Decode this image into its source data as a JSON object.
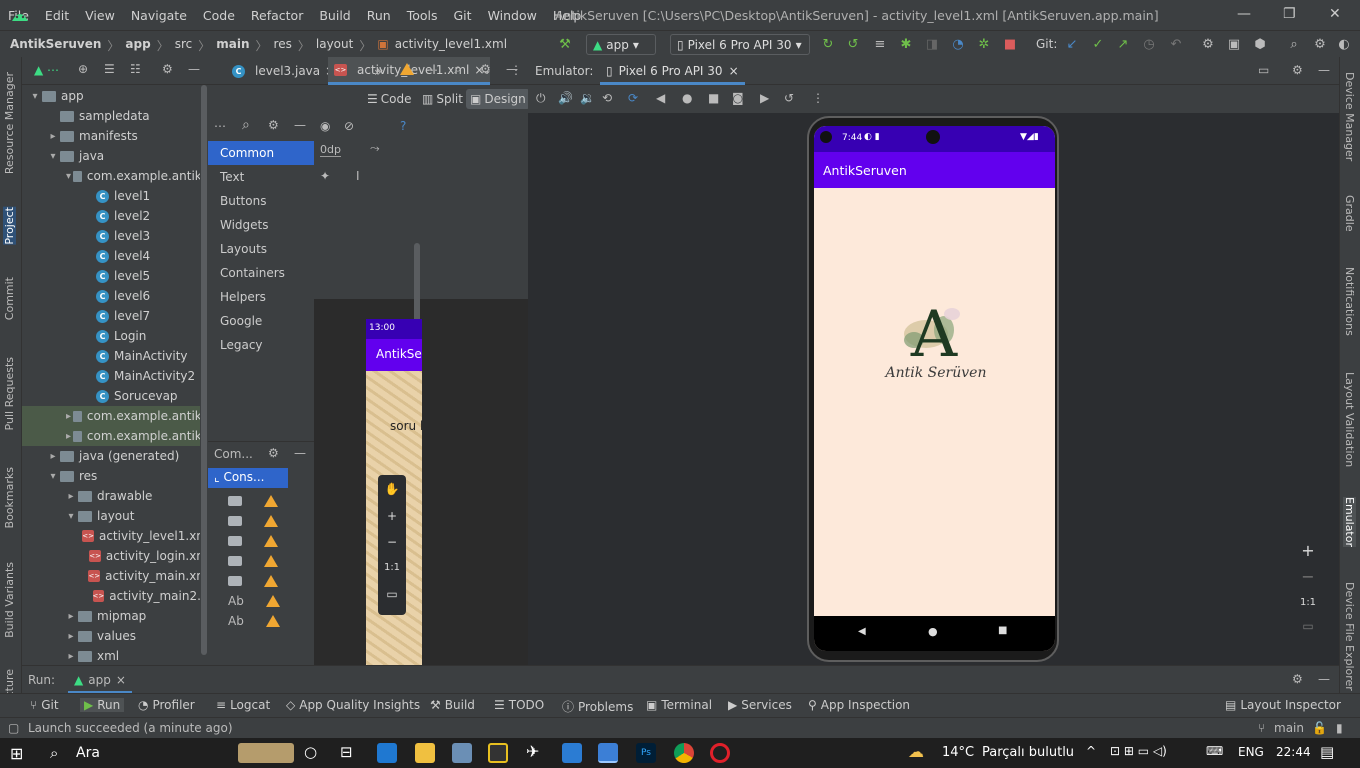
{
  "titlebar": {
    "menu": [
      "File",
      "Edit",
      "View",
      "Navigate",
      "Code",
      "Refactor",
      "Build",
      "Run",
      "Tools",
      "Git",
      "Window",
      "Help"
    ],
    "title": "AntikSeruven [C:\\Users\\PC\\Desktop\\AntikSeruven] - activity_level1.xml [AntikSeruven.app.main]"
  },
  "navbar": {
    "crumbs": [
      "AntikSeruven",
      "app",
      "src",
      "main",
      "res",
      "layout",
      "activity_level1.xml"
    ],
    "run_config": "app",
    "device": "Pixel 6 Pro API 30",
    "git_label": "Git:"
  },
  "left_strip": [
    "Resource Manager",
    "Project",
    "Commit",
    "Pull Requests",
    "Bookmarks",
    "Build Variants",
    "Structure"
  ],
  "right_strip": [
    "Device Manager",
    "Gradle",
    "Notifications",
    "Layout Validation",
    "Emulator",
    "Device File Explorer"
  ],
  "project_tree": [
    {
      "label": "app",
      "arrow": "▼",
      "icon": "folder"
    },
    {
      "label": "sampledata",
      "arrow": "",
      "icon": "folder"
    },
    {
      "label": "manifests",
      "arrow": "▶",
      "icon": "folder"
    },
    {
      "label": "java",
      "arrow": "▼",
      "icon": "folder"
    },
    {
      "label": "com.example.antiks",
      "arrow": "▼",
      "icon": "folder"
    },
    {
      "label": "level1",
      "arrow": "",
      "icon": "class"
    },
    {
      "label": "level2",
      "arrow": "",
      "icon": "class"
    },
    {
      "label": "level3",
      "arrow": "",
      "icon": "class"
    },
    {
      "label": "level4",
      "arrow": "",
      "icon": "class"
    },
    {
      "label": "level5",
      "arrow": "",
      "icon": "class"
    },
    {
      "label": "level6",
      "arrow": "",
      "icon": "class"
    },
    {
      "label": "level7",
      "arrow": "",
      "icon": "class"
    },
    {
      "label": "Login",
      "arrow": "",
      "icon": "class"
    },
    {
      "label": "MainActivity",
      "arrow": "",
      "icon": "class"
    },
    {
      "label": "MainActivity2",
      "arrow": "",
      "icon": "class"
    },
    {
      "label": "Sorucevap",
      "arrow": "",
      "icon": "class"
    },
    {
      "label": "com.example.antiks",
      "arrow": "▶",
      "icon": "folder",
      "selected": true
    },
    {
      "label": "com.example.antiks",
      "arrow": "▶",
      "icon": "folder",
      "selected": true
    },
    {
      "label": "java (generated)",
      "arrow": "▶",
      "icon": "folder"
    },
    {
      "label": "res",
      "arrow": "▼",
      "icon": "folder"
    },
    {
      "label": "drawable",
      "arrow": "▶",
      "icon": "folder"
    },
    {
      "label": "layout",
      "arrow": "▼",
      "icon": "folder"
    },
    {
      "label": "activity_level1.xm",
      "arrow": "",
      "icon": "xml"
    },
    {
      "label": "activity_login.xm",
      "arrow": "",
      "icon": "xml"
    },
    {
      "label": "activity_main.xm",
      "arrow": "",
      "icon": "xml"
    },
    {
      "label": "activity_main2.x",
      "arrow": "",
      "icon": "xml"
    },
    {
      "label": "mipmap",
      "arrow": "▶",
      "icon": "folder"
    },
    {
      "label": "values",
      "arrow": "▶",
      "icon": "folder"
    },
    {
      "label": "xml",
      "arrow": "▶",
      "icon": "folder"
    }
  ],
  "editor": {
    "tabs": [
      "level3.java",
      "activity_level1.xml"
    ],
    "modes": [
      "Code",
      "Split",
      "Design"
    ],
    "zero_dp": "0dp",
    "palette": [
      "Common",
      "Text",
      "Buttons",
      "Widgets",
      "Layouts",
      "Containers",
      "Helpers",
      "Google",
      "Legacy"
    ],
    "tree_header": "Com...",
    "tree_root": "Cons...",
    "tree_ab": [
      "Ab",
      "Ab"
    ],
    "preview_time": "13:00",
    "preview_title": "AntikSe",
    "preview_text": "soru b",
    "zoom_ratio": "1:1"
  },
  "emulator": {
    "label": "Emulator:",
    "tab": "Pixel 6 Pro API 30",
    "phone_time": "7:44",
    "app_title": "AntikSeruven",
    "logo_letter": "A",
    "logo_text": "Antik Serüven",
    "zoom_ratio": "1:1"
  },
  "run": {
    "label": "Run:",
    "config": "app"
  },
  "bottom_tools": [
    "Git",
    "Run",
    "Profiler",
    "Logcat",
    "App Quality Insights",
    "Build",
    "TODO",
    "Problems",
    "Terminal",
    "Services",
    "App Inspection",
    "Layout Inspector"
  ],
  "status": {
    "message": "Launch succeeded (a minute ago)",
    "branch": "main"
  },
  "taskbar": {
    "search": "Ara",
    "temp": "14°C",
    "weather": "Parçalı bulutlu",
    "lang": "ENG",
    "time": "22:44"
  }
}
